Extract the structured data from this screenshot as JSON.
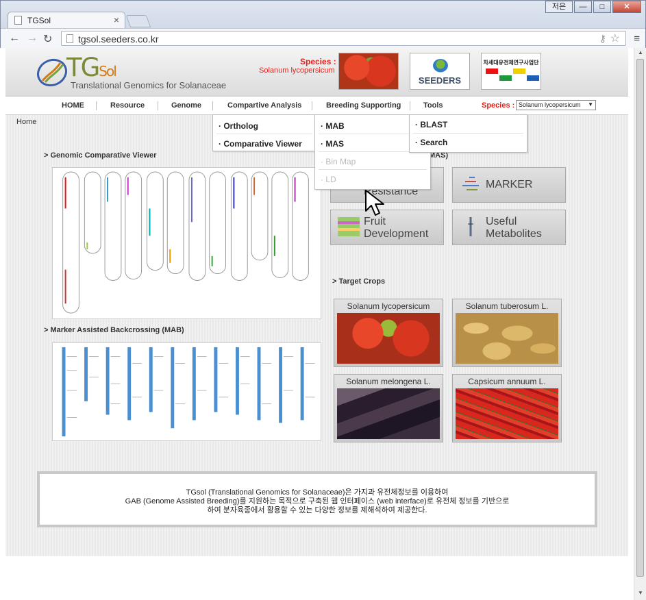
{
  "browser": {
    "tab_title": "TGSol",
    "tab_close": "×",
    "url": "tgsol.seeders.co.kr",
    "window_user": "저은",
    "win_min": "—",
    "win_max": "□",
    "win_close": "✕"
  },
  "header": {
    "logo_main": "TG",
    "logo_sol": "Sol",
    "logo_subtitle": "Translational Genomics for Solanaceae",
    "species_label": "Species :",
    "species_name": "Solanum lycopersicum",
    "seeders_label": "SEEDERS",
    "govt_label": "차세대유전체연구사업단"
  },
  "nav": {
    "items": [
      "HOME",
      "Resource",
      "Genome",
      "Compartive Analysis",
      "Breeding Supporting",
      "Tools"
    ],
    "species_label": "Species :",
    "species_select": "Solanum lycopersicum"
  },
  "breadcrumb": "Home",
  "dropdowns": {
    "comparative": [
      "· Ortholog",
      "· Comparative Viewer"
    ],
    "breeding": [
      "· MAB",
      "· MAS",
      "· Bin Map",
      "· LD"
    ],
    "tools": [
      "· BLAST",
      "· Search"
    ]
  },
  "sections": {
    "genomic_viewer": "> Genomic Comparative Viewer",
    "mab": "> Marker Assisted Backcrossing (MAB)",
    "mas_fragment": "MAS)",
    "target_crops": "> Target Crops"
  },
  "tiles": {
    "resistance": "Resistance",
    "marker": "MARKER",
    "fruit_1": "Fruit",
    "fruit_2": "Development",
    "useful_1": "Useful",
    "useful_2": "Metabolites"
  },
  "crops": [
    {
      "name": "Solanum lycopersicum",
      "color": "#c8361c"
    },
    {
      "name": "Solanum tuberosum L.",
      "color": "#d9b25c"
    },
    {
      "name": "Solanum melongena L.",
      "color": "#3a2a3a"
    },
    {
      "name": "Capsicum annuum L.",
      "color": "#c0201c"
    }
  ],
  "info": {
    "line1": "TGsol (Translational Genomics for Solanaceae)은 가지과 유전체정보를 이용하여",
    "line2": "GAB (Genome Assisted Breeding)를 지원하는 목적으로 구축된 웹 인터페이스 (web interface)로 유전체 정보를 기반으로",
    "line3": "하여 분자육종에서 활용할 수 있는 다양한 정보를 제해석하여 제공한다."
  },
  "colors": {
    "accent_red": "#e2211b",
    "logo_green": "#7a8a36",
    "logo_orange": "#d27a18"
  }
}
